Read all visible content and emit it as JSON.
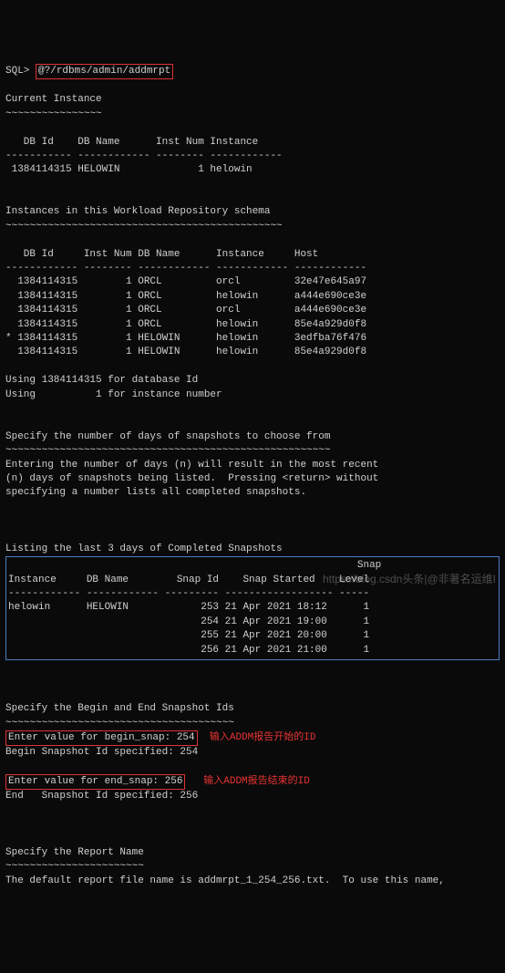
{
  "prompt_label": "SQL>",
  "command": "@?/rdbms/admin/addmrpt",
  "section1": {
    "title": "Current Instance",
    "div": "~~~~~~~~~~~~~~~~",
    "headers": "   DB Id    DB Name      Inst Num Instance",
    "sep": "----------- ------------ -------- ------------",
    "row": " 1384114315 HELOWIN             1 helowin"
  },
  "section2": {
    "title": "Instances in this Workload Repository schema",
    "div": "~~~~~~~~~~~~~~~~~~~~~~~~~~~~~~~~~~~~~~~~~~~~~~",
    "headers": "   DB Id     Inst Num DB Name      Instance     Host",
    "sep": "------------ -------- ------------ ------------ ------------",
    "rows": [
      "  1384114315        1 ORCL         orcl         32e47e645a97",
      "  1384114315        1 ORCL         helowin      a444e690ce3e",
      "  1384114315        1 ORCL         orcl         a444e690ce3e",
      "  1384114315        1 ORCL         helowin      85e4a929d0f8",
      "* 1384114315        1 HELOWIN      helowin      3edfba76f476",
      "  1384114315        1 HELOWIN      helowin      85e4a929d0f8"
    ],
    "footer1": "Using 1384114315 for database Id",
    "footer2": "Using          1 for instance number"
  },
  "section3": {
    "title": "Specify the number of days of snapshots to choose from",
    "div": "~~~~~~~~~~~~~~~~~~~~~~~~~~~~~~~~~~~~~~~~~~~~~~~~~~~~~~",
    "text1": "Entering the number of days (n) will result in the most recent",
    "text2": "(n) days of snapshots being listed.  Pressing <return> without",
    "text3": "specifying a number lists all completed snapshots."
  },
  "section4": {
    "title": "Listing the last 3 days of Completed Snapshots",
    "hdr1": "                                                          Snap",
    "hdr2": "Instance     DB Name        Snap Id    Snap Started    Level",
    "sep": "------------ ------------ --------- ------------------ -----",
    "rows": [
      "helowin      HELOWIN            253 21 Apr 2021 18:12      1",
      "                                254 21 Apr 2021 19:00      1",
      "                                255 21 Apr 2021 20:00      1",
      "                                256 21 Apr 2021 21:00      1"
    ]
  },
  "section5": {
    "title": "Specify the Begin and End Snapshot Ids",
    "div": "~~~~~~~~~~~~~~~~~~~~~~~~~~~~~~~~~~~~~~",
    "begin_prompt": "Enter value for begin_snap: 254",
    "begin_note": "  输入ADDM报告开始的ID",
    "begin_confirm": "Begin Snapshot Id specified: 254",
    "end_prompt": "Enter value for end_snap: 256",
    "end_note": "   输入ADDM报告结束的ID",
    "end_confirm": "End   Snapshot Id specified: 256"
  },
  "section6": {
    "title": "Specify the Report Name",
    "div": "~~~~~~~~~~~~~~~~~~~~~~~",
    "text": "The default report file name is addmrpt_1_254_256.txt.  To use this name,"
  },
  "watermark": "https://blog.csdn头条|@非著名运维I"
}
